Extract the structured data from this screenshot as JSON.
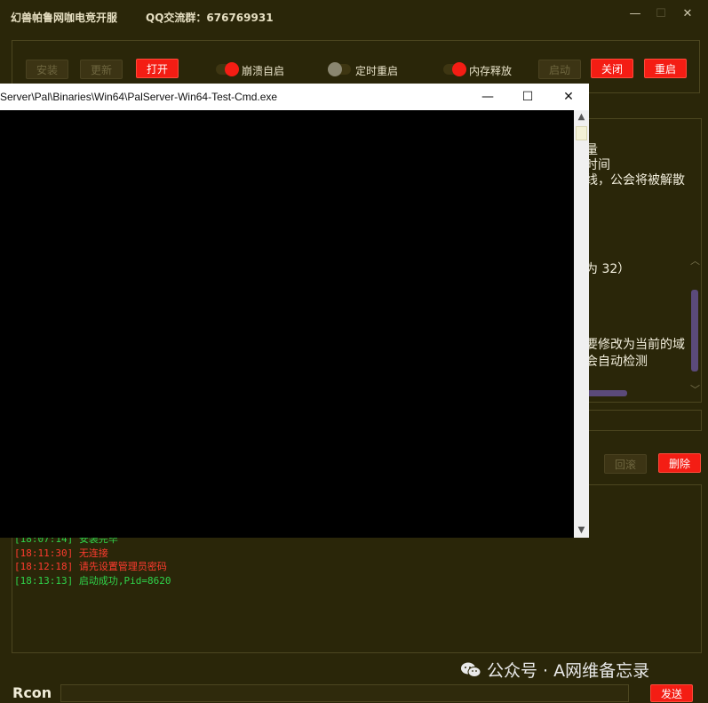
{
  "app": {
    "title": "幻兽帕鲁网咖电竞开服",
    "qq_group": "QQ交流群：676769931",
    "window_controls": {
      "minimize": "—",
      "maximize": "☐",
      "close": "✕"
    }
  },
  "toolbar": {
    "install": "安装",
    "update": "更新",
    "open": "打开",
    "crash_restart": {
      "label": "崩溃自启",
      "on": true
    },
    "timed_restart": {
      "label": "定时重启",
      "on": false
    },
    "memory_release": {
      "label": "内存释放",
      "on": true
    },
    "start": "启动",
    "close": "关闭",
    "restart": "重启"
  },
  "background_text": [
    "量",
    "时间",
    "线，公会将被解散",
    "为 32）",
    "要修改为当前的域",
    "会自动检测"
  ],
  "actions": {
    "rollback": "回滚",
    "delete": "删除"
  },
  "log": [
    {
      "time": "[18:07:14]",
      "text": "安装完毕",
      "level": "green"
    },
    {
      "time": "[18:11:30]",
      "text": "无连接",
      "level": "red"
    },
    {
      "time": "[18:12:18]",
      "text": "请先设置管理员密码",
      "level": "red"
    },
    {
      "time": "[18:13:13]",
      "text": "启动成功,Pid=8620",
      "level": "green"
    }
  ],
  "rcon": {
    "label": "Rcon",
    "send": "发送"
  },
  "watermark": "公众号 · A网维备忘录",
  "console": {
    "title": "Server\\Pal\\Binaries\\Win64\\PalServer-Win64-Test-Cmd.exe",
    "controls": {
      "minimize": "—",
      "maximize": "☐",
      "close": "✕"
    }
  },
  "colors": {
    "background": "#2a2609",
    "accent": "#f41d14",
    "log_green": "#2fd34a",
    "log_red": "#ff3b2f"
  }
}
